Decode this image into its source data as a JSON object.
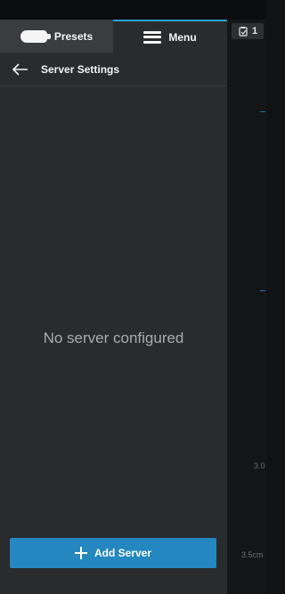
{
  "colors": {
    "panel_bg": "#2a2b2d",
    "presets_tab_bg": "#3a3c3f",
    "accent": "#2aa3d8",
    "button_bg": "#2487bf",
    "viewer_bg": "#131517"
  },
  "tabs": [
    {
      "label": "Presets",
      "icon": "probe-icon"
    },
    {
      "label": "Menu",
      "icon": "hamburger-icon"
    }
  ],
  "header": {
    "title": "Server Settings",
    "back_icon": "back-arrow-icon"
  },
  "empty_state": {
    "message": "No server configured"
  },
  "footer": {
    "add_button_label": "Add Server",
    "add_icon": "plus-icon"
  },
  "viewer": {
    "clip_count": "1",
    "clip_icon": "clipboard-icon",
    "depth_labels": [
      "3.0",
      "3.5cm"
    ]
  }
}
